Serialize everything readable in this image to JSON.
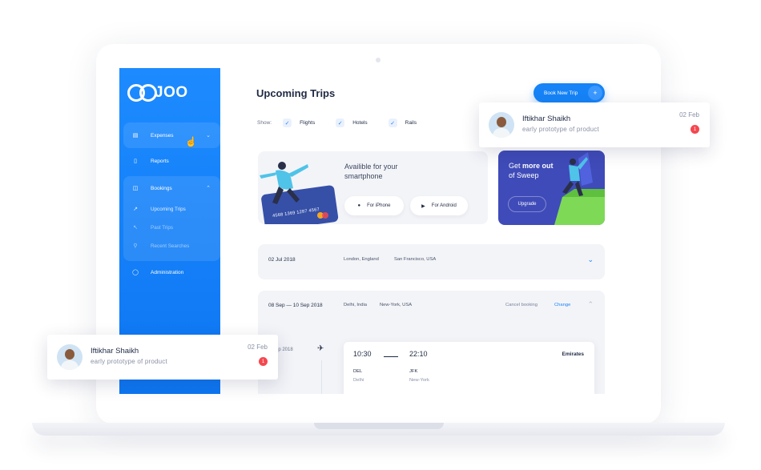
{
  "sidebar": {
    "logo": "JOO",
    "items": [
      {
        "label": "Expenses",
        "icon": "file-icon"
      },
      {
        "label": "Reports",
        "icon": "document-icon"
      },
      {
        "label": "Bookings",
        "icon": "briefcase-icon"
      },
      {
        "label": "Upcoming Trips",
        "icon": "arrow-up-right-icon"
      },
      {
        "label": "Past Trips",
        "icon": "arrow-up-left-icon"
      },
      {
        "label": "Recent Searches",
        "icon": "search-icon"
      },
      {
        "label": "Administration",
        "icon": "shield-icon"
      }
    ]
  },
  "header": {
    "title": "Upcoming Trips",
    "book_button": "Book New Trip",
    "book_plus": "+"
  },
  "filters": {
    "label": "Show:",
    "options": [
      "Flights",
      "Hotels",
      "Rails"
    ]
  },
  "promo": {
    "text": "Availible for your smartphone",
    "iphone": "For iPhone",
    "android": "For Android",
    "card_number": "4568 1369 1287 4567"
  },
  "upsell": {
    "prefix": "Get",
    "bold": "more out",
    "suffix": "of Sweep",
    "button": "Upgrade"
  },
  "trips": [
    {
      "date": "02 Jul 2018",
      "from": "London, England",
      "to": "San Francisco, USA"
    },
    {
      "date": "08 Sep — 10 Sep 2018",
      "from": "Delhi, India",
      "to": "New-York, USA",
      "cancel": "Cancel booking",
      "change": "Change"
    }
  ],
  "flight": {
    "partial_date": "ep 2018",
    "depart_time": "10:30",
    "arrive_time": "22:10",
    "airline": "Emirates",
    "from_code": "DEL",
    "from_city": "Delhi",
    "to_code": "JFK",
    "to_city": "New-York"
  },
  "notifications": [
    {
      "name": "Iftikhar Shaikh",
      "message": "early prototype of product",
      "date": "02 Feb",
      "count": "1"
    },
    {
      "name": "Iftikhar Shaikh",
      "message": "early prototype of product",
      "date": "02 Feb",
      "count": "1"
    }
  ],
  "colors": {
    "accent": "#1683f7",
    "sidebar": "#0d76f2",
    "upsell": "#3f4bb8",
    "badge": "#f5474e"
  }
}
